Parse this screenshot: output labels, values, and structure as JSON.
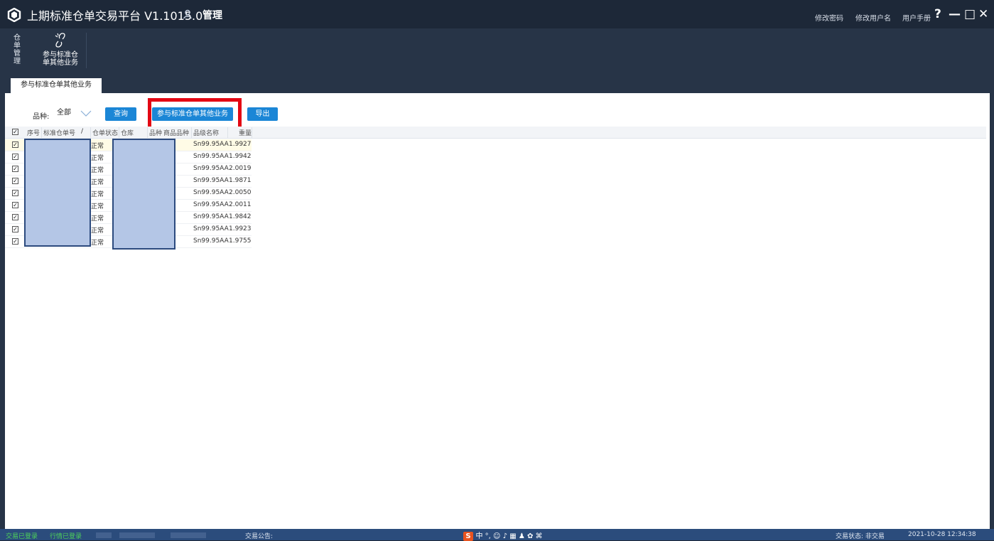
{
  "titlebar": {
    "app_title": "上期标准仓单交易平台 V1.1015.0",
    "user_icon": "user-icon",
    "user_name": "管理",
    "change_password": "修改密码",
    "change_username": "修改用户名",
    "user_manual": "用户手册",
    "help": "?",
    "minimize": "—",
    "maximize": "□",
    "close": "✕"
  },
  "ribbon": {
    "group_label": "仓单管理",
    "button_line1": "参与标准仓",
    "button_line2": "单其他业务",
    "button_icon": "link-icon"
  },
  "tabs": [
    {
      "label": "参与标准仓单其他业务",
      "active": true
    }
  ],
  "toolbar": {
    "variety_label": "品种:",
    "variety_value": "全部",
    "query_label": "查询",
    "participate_label": "参与标准仓单其他业务",
    "export_label": "导出"
  },
  "grid": {
    "columns": [
      "序号",
      "标准仓单号",
      "仓单状态",
      "仓库",
      "品种",
      "商品品种",
      "品级名称",
      "重量"
    ],
    "rows": [
      {
        "checked": true,
        "status": "正常",
        "grade": "Sn99.95AA",
        "weight": "1.9927"
      },
      {
        "checked": true,
        "status": "正常",
        "grade": "Sn99.95AA",
        "weight": "1.9942"
      },
      {
        "checked": true,
        "status": "正常",
        "grade": "Sn99.95AA",
        "weight": "2.0019"
      },
      {
        "checked": true,
        "status": "正常",
        "grade": "Sn99.95AA",
        "weight": "1.9871"
      },
      {
        "checked": true,
        "status": "正常",
        "grade": "Sn99.95AA",
        "weight": "2.0050"
      },
      {
        "checked": true,
        "status": "正常",
        "grade": "Sn99.95AA",
        "weight": "2.0011"
      },
      {
        "checked": true,
        "status": "正常",
        "grade": "Sn99.95AA",
        "weight": "1.9842"
      },
      {
        "checked": true,
        "status": "正常",
        "grade": "Sn99.95AA",
        "weight": "1.9923"
      },
      {
        "checked": true,
        "status": "正常",
        "grade": "Sn99.95AA",
        "weight": "1.9755"
      }
    ]
  },
  "statusbar": {
    "trade_login": "交易已登录",
    "quote_login": "行情已登录",
    "notice_label": "交易公告:",
    "trade_status": "交易状态: 非交易",
    "datetime": "2021-10-28 12:34:38",
    "ime_text": "中 °, ☺ ♪ ▦ ♟ ✿ ⌘"
  },
  "colors": {
    "titlebar_bg": "#1d2838",
    "ribbon_bg": "#273447",
    "button_blue": "#1b86d6",
    "highlight_red": "#e30613",
    "statusbar_bg": "#2b4c7c",
    "status_green": "#4ed25a",
    "redaction_fill": "#b4c6e6"
  }
}
